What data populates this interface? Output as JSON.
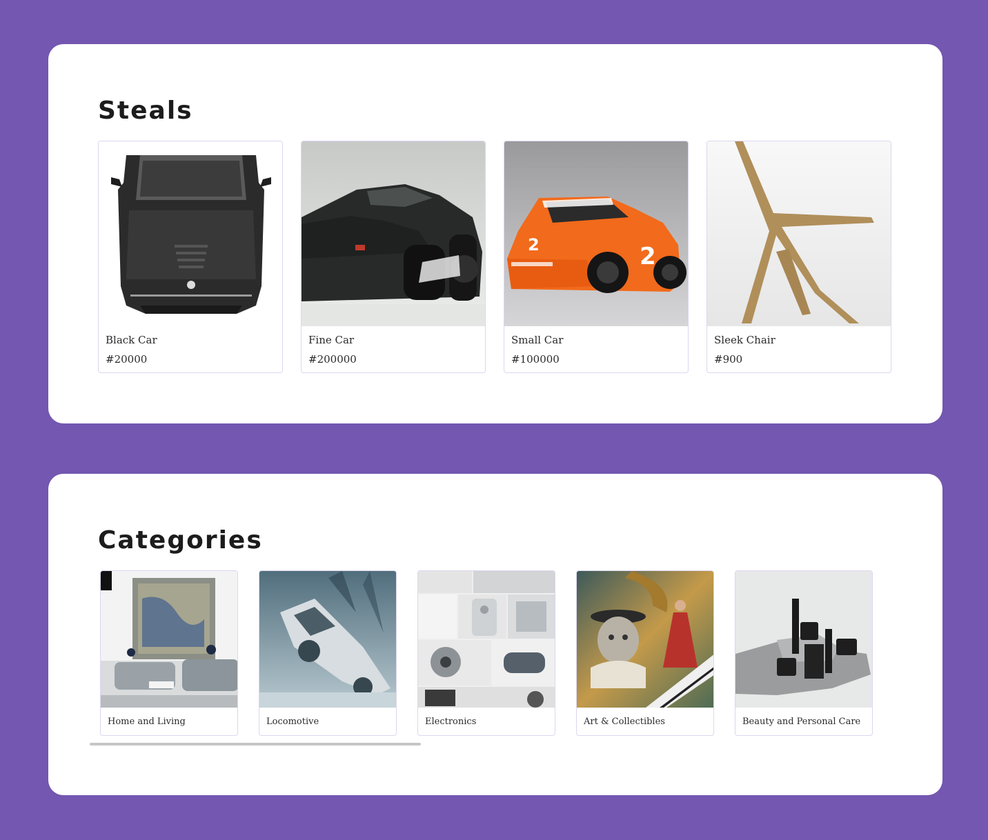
{
  "steals": {
    "title": "Steals",
    "items": [
      {
        "name": "Black Car",
        "price": "#20000"
      },
      {
        "name": "Fine Car",
        "price": "#200000"
      },
      {
        "name": "Small Car",
        "price": "#100000"
      },
      {
        "name": "Sleek Chair",
        "price": "#900"
      }
    ]
  },
  "categories": {
    "title": "Categories",
    "items": [
      {
        "label": "Home and Living"
      },
      {
        "label": "Locomotive"
      },
      {
        "label": "Electronics"
      },
      {
        "label": "Art & Collectibles"
      },
      {
        "label": "Beauty and Personal Care"
      }
    ]
  },
  "colors": {
    "background": "#7357b0",
    "panel": "#ffffff",
    "card_border": "#dcd6ef"
  }
}
